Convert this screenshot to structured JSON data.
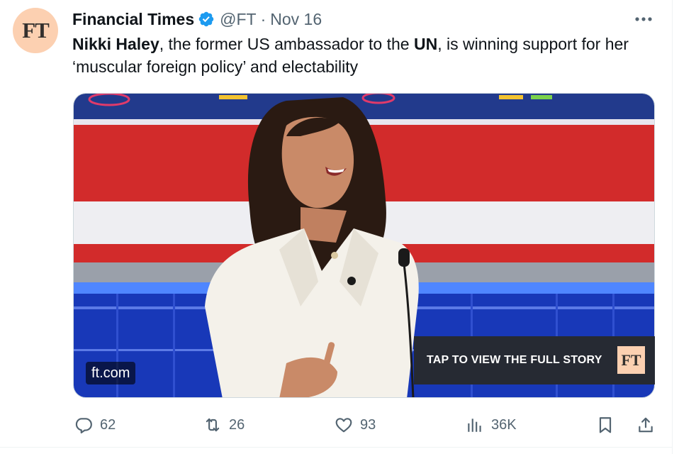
{
  "tweet": {
    "author": {
      "avatar_text": "FT",
      "name": "Financial Times",
      "handle": "@FT",
      "separator": "·",
      "date": "Nov 16"
    },
    "text": {
      "part1": "Nikki Haley",
      "part2": ", the former US ambassador to the ",
      "part3": "UN",
      "part4": ", is winning support for her ‘muscular foreign policy’ and electability"
    },
    "card": {
      "source": "ft.com",
      "cta": "TAP TO VIEW THE FULL STORY",
      "logo_text": "FT"
    },
    "actions": {
      "replies": "62",
      "reposts": "26",
      "likes": "93",
      "views": "36K"
    },
    "colors": {
      "ft_pink": "#fcd0b1",
      "verified_blue": "#1d9bf0",
      "muted_text": "#536471"
    },
    "icons": {
      "verified": "verified-badge-icon",
      "more": "more-icon",
      "reply": "reply-icon",
      "repost": "repost-icon",
      "like": "like-icon",
      "views": "views-icon",
      "bookmark": "bookmark-icon",
      "share": "share-icon"
    }
  }
}
